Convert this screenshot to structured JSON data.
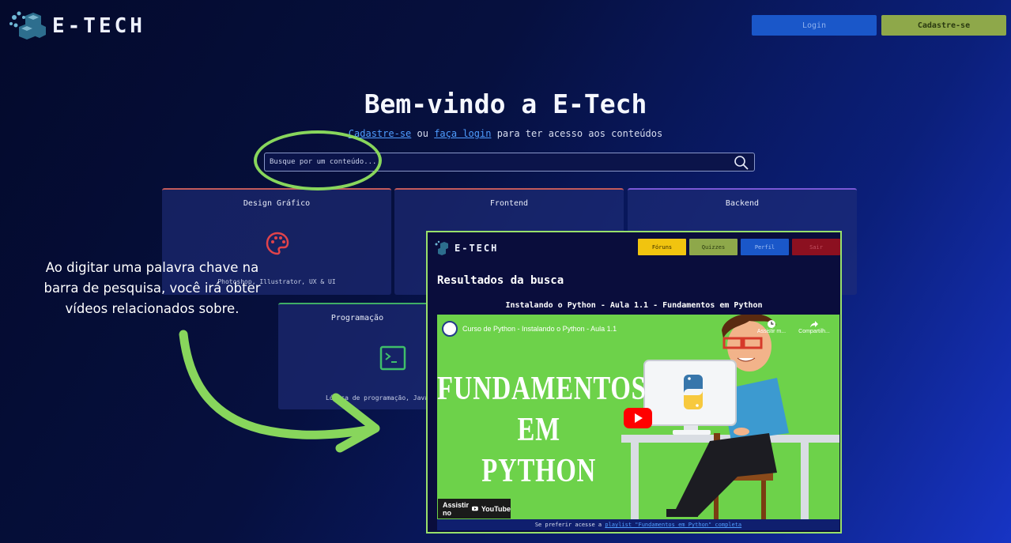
{
  "header": {
    "logo_text": "E-TECH",
    "login_label": "Login",
    "signup_label": "Cadastre-se"
  },
  "hero": {
    "title": "Bem-vindo a E-Tech",
    "signup_link": "Cadastre-se",
    "or_text": "ou",
    "login_link": "faça login",
    "suffix_text": "para ter acesso aos conteúdos"
  },
  "search": {
    "placeholder": "Busque por um conteúdo..."
  },
  "cards": {
    "design": {
      "title": "Design Gráfico",
      "desc": "Photoshop, Illustrator, UX & UI"
    },
    "frontend": {
      "title": "Frontend"
    },
    "backend": {
      "title": "Backend"
    },
    "programming": {
      "title": "Programação",
      "desc": "Lógica de programação, Java,"
    }
  },
  "annotation": {
    "text": "Ao digitar uma palavra chave na barra de pesquisa, você irá obter vídeos relacionados sobre."
  },
  "popup": {
    "logo_text": "E-TECH",
    "nav": {
      "forums": "Fóruns",
      "quizzes": "Quizzes",
      "profile": "Perfil",
      "exit": "Sair"
    },
    "results_heading": "Resultados da busca",
    "video_heading": "Instalando o Python - Aula 1.1 - Fundamentos em Python",
    "video": {
      "yt_title": "Curso de Python - Instalando o Python - Aula 1.1",
      "thumb_line1": "FUNDAMENTOS",
      "thumb_line2": "EM",
      "thumb_line3": "PYTHON",
      "watch_later": "Assistir m...",
      "share": "Compartilh...",
      "watch_on": "Assistir no",
      "youtube": "YouTube"
    },
    "footer_prefix": "Se preferir acesse a",
    "footer_link": "playlist \"Fundamentos em Python\" completa"
  },
  "colors": {
    "login_button": "#1a57c9",
    "signup_button": "#8ea84a",
    "annotation_green": "#88d65c",
    "forums": "#f1c40f",
    "exit": "#8c1020"
  }
}
